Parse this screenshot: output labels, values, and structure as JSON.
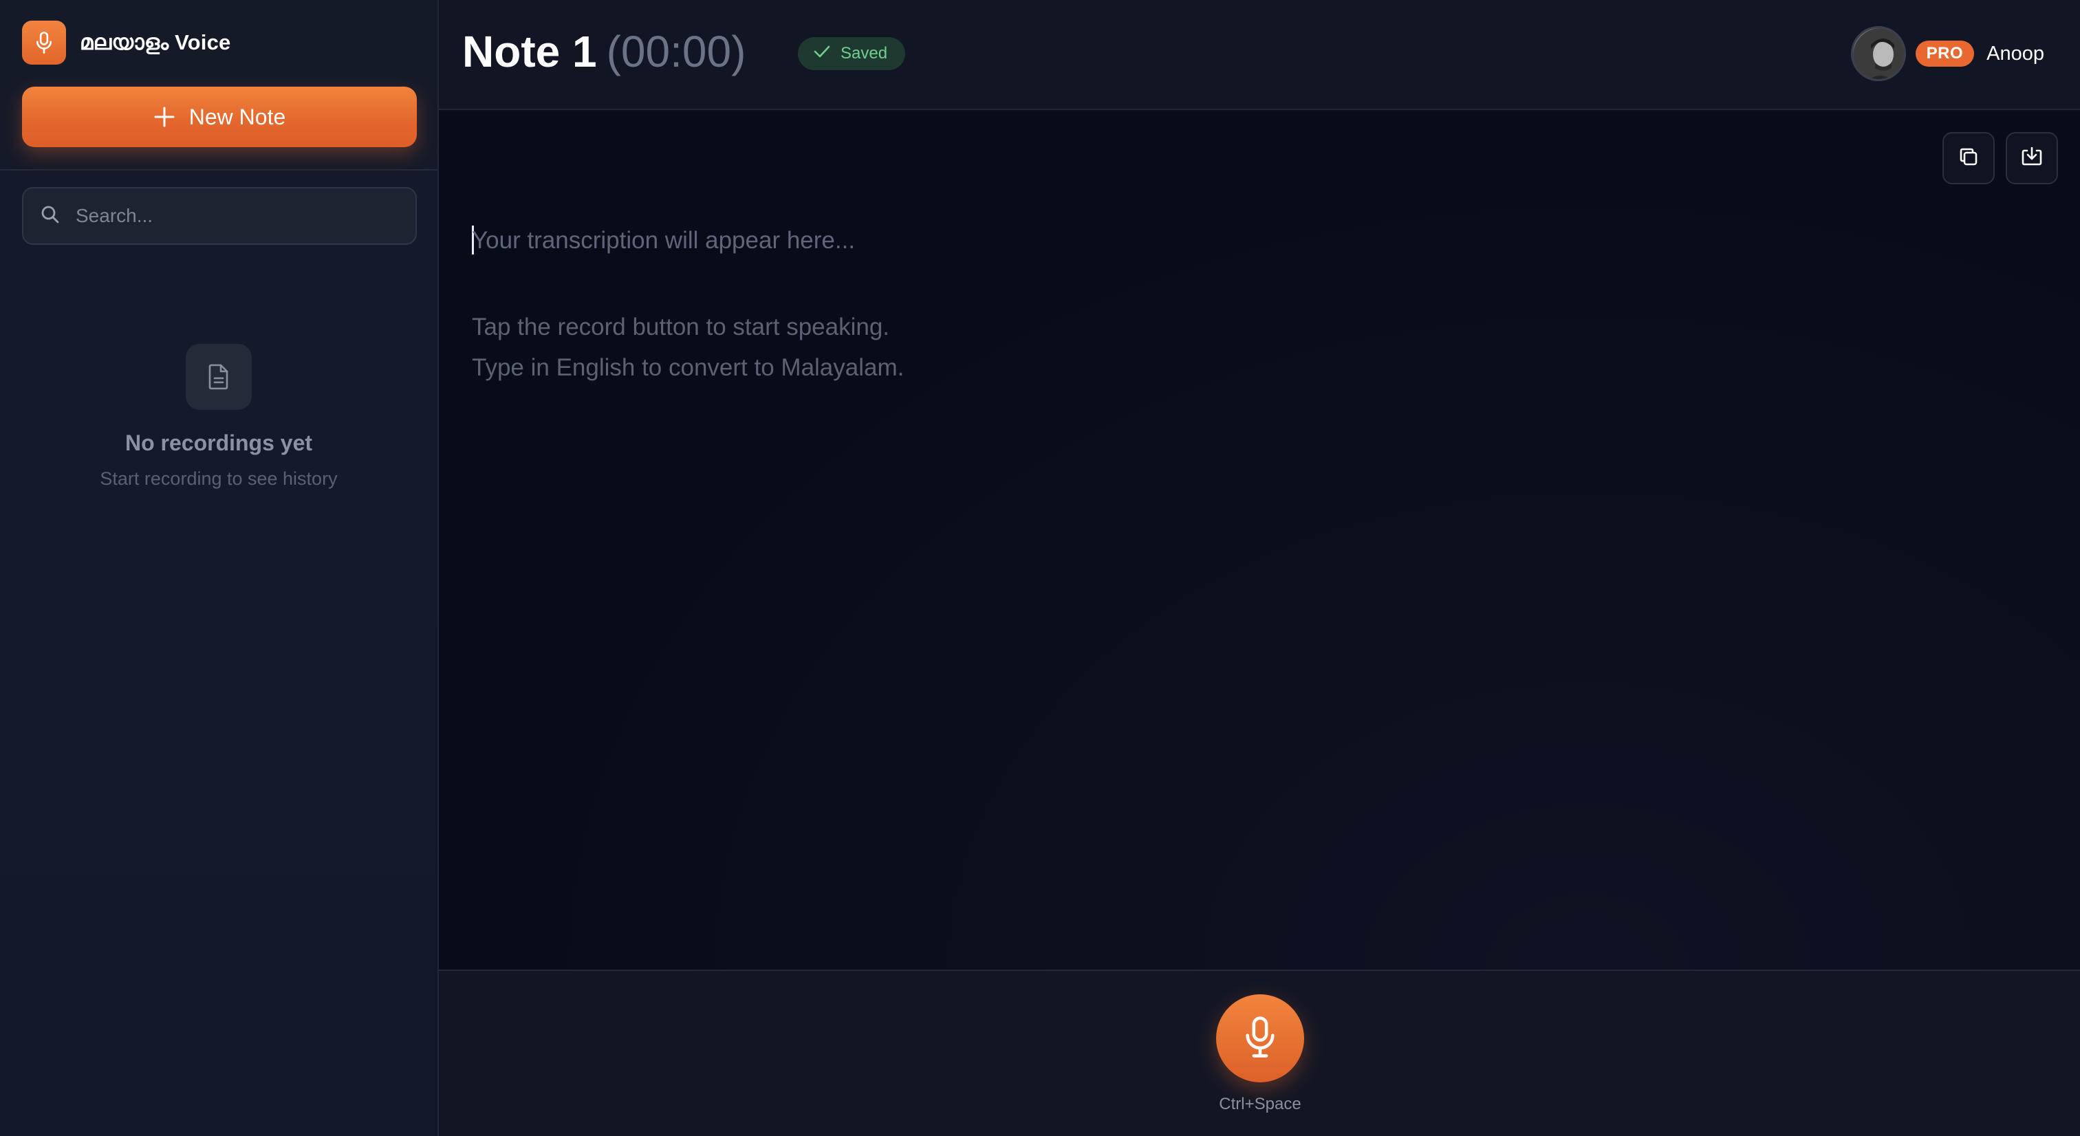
{
  "sidebar": {
    "brand_name": "മലയാളം Voice",
    "new_note_label": "New Note",
    "search_placeholder": "Search...",
    "empty_title": "No recordings yet",
    "empty_subtitle": "Start recording to see history"
  },
  "header": {
    "note_title": "Note 1",
    "timer": "(00:00)",
    "status": "Saved",
    "plan_badge": "PRO",
    "username": "Anoop"
  },
  "editor": {
    "placeholder": "Your transcription will appear here...",
    "hint_line1": "Tap the record button to start speaking.",
    "hint_line2": "Type in English to convert to Malayalam."
  },
  "footer": {
    "shortcut": "Ctrl+Space"
  },
  "colors": {
    "accent": "#e8682f",
    "saved_text": "#6fcf8f",
    "saved_bg": "#1e3a30"
  }
}
